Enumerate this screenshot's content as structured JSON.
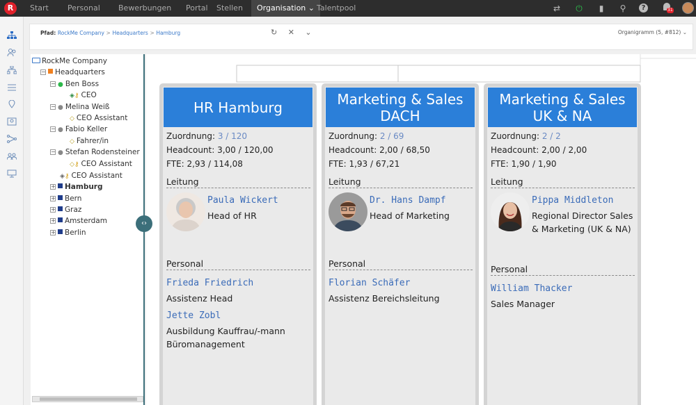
{
  "topnav": {
    "logo": "R",
    "items": [
      "Start",
      "Personal",
      "Bewerbungen",
      "Portal",
      "Stellen",
      "Organisation",
      "Talentpool"
    ],
    "active_caret": "⌄"
  },
  "topicons": {
    "swap": "⇄",
    "power": "⏻",
    "bookmark": "▮",
    "search": "⚲",
    "help": "?",
    "bell": "🔔",
    "badge": "31"
  },
  "leftnav_icons": [
    "org-chart-icon",
    "people-icon",
    "hierarchy-icon",
    "list-icon",
    "location-icon",
    "id-card-icon",
    "network-icon",
    "users-icon",
    "presentation-icon"
  ],
  "breadcrumb": {
    "label": "Pfad:",
    "items": [
      "RockMe Company",
      "Headquarters",
      "Hamburg"
    ],
    "sep": ">",
    "actions": "↻ ✕ ⌄",
    "org_select": "Organigramm (5, #812) ⌄"
  },
  "tree": {
    "root": "RockMe Company",
    "hq": "Headquarters",
    "people": [
      {
        "name": "Ben Boss",
        "role": "CEO"
      },
      {
        "name": "Melina Weiß",
        "role": "CEO Assistant"
      },
      {
        "name": "Fabio Keller",
        "role": "Fahrer/in"
      },
      {
        "name": "Stefan Rodensteiner",
        "role": "CEO Assistant"
      }
    ],
    "hq_role": "CEO Assistant",
    "units": [
      "Hamburg",
      "Bern",
      "Graz",
      "Amsterdam",
      "Berlin"
    ],
    "toggle_minus": "−",
    "toggle_plus": "+",
    "splitter": "‹›"
  },
  "cards": [
    {
      "title": "HR Hamburg",
      "zuordnung_label": "Zuordnung:",
      "zuordnung_a": "3",
      "zuordnung_sep": "/",
      "zuordnung_b": "120",
      "headcount": "Headcount: 3,00 / 120,00",
      "fte": "FTE: 2,93 / 114,08",
      "leitung_label": "Leitung",
      "lead_name": "Paula Wickert",
      "lead_role": "Head of HR",
      "personal_label": "Personal",
      "staff": [
        {
          "name": "Frieda Friedrich",
          "role": "Assistenz Head"
        },
        {
          "name": "Jette Zobl",
          "role": "Ausbildung Kauffrau/-mann\nBüromanagement"
        }
      ]
    },
    {
      "title": "Marketing & Sales DACH",
      "zuordnung_label": "Zuordnung:",
      "zuordnung_a": "2",
      "zuordnung_sep": "/",
      "zuordnung_b": "69",
      "headcount": "Headcount: 2,00 / 68,50",
      "fte": "FTE: 1,93 / 67,21",
      "leitung_label": "Leitung",
      "lead_name": "Dr. Hans Dampf",
      "lead_role": "Head of Marketing",
      "personal_label": "Personal",
      "staff": [
        {
          "name": "Florian Schäfer",
          "role": "Assistenz Bereichsleitung"
        }
      ]
    },
    {
      "title": "Marketing & Sales UK & NA",
      "zuordnung_label": "Zuordnung:",
      "zuordnung_a": "2",
      "zuordnung_sep": "/",
      "zuordnung_b": "2",
      "headcount": "Headcount: 2,00 / 2,00",
      "fte": "FTE: 1,90 / 1,90",
      "leitung_label": "Leitung",
      "lead_name": "Pippa Middleton",
      "lead_role": "Regional Director Sales\n& Marketing (UK & NA)",
      "personal_label": "Personal",
      "staff": [
        {
          "name": "William Thacker",
          "role": "Sales Manager"
        }
      ]
    }
  ],
  "colors": {
    "topbar": "#2d2d2d",
    "card_header": "#2b7fd9",
    "name_link": "#3a6bb8",
    "tree_panel_border": "#3c6f7a"
  }
}
